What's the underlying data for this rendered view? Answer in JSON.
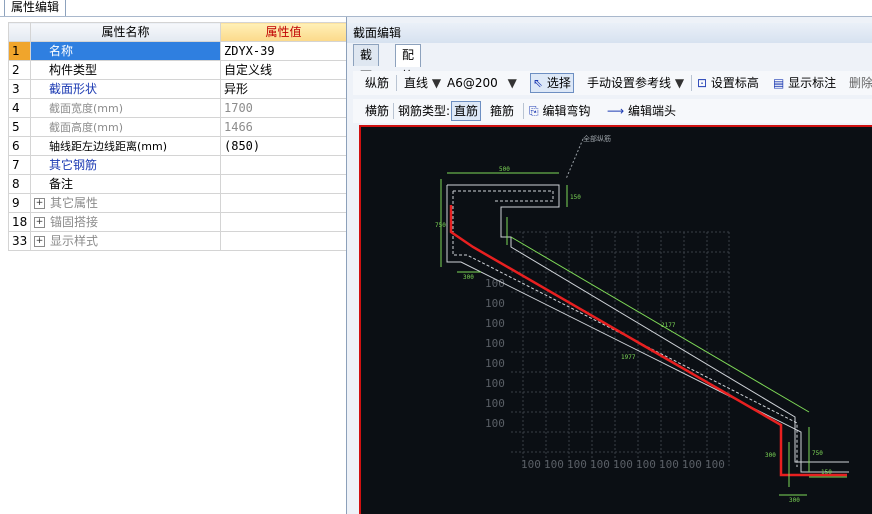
{
  "top_tab": {
    "label": "属性编辑"
  },
  "props": {
    "header": {
      "name": "属性名称",
      "value": "属性值"
    },
    "rows": [
      {
        "num": "1",
        "name": "名称",
        "value": "ZDYX-39"
      },
      {
        "num": "2",
        "name": "构件类型",
        "value": "自定义线"
      },
      {
        "num": "3",
        "name": "截面形状",
        "value": "异形"
      },
      {
        "num": "4",
        "name": "截面宽度(mm)",
        "value": "1700"
      },
      {
        "num": "5",
        "name": "截面高度(mm)",
        "value": "1466"
      },
      {
        "num": "6",
        "name": "轴线距左边线距离(mm)",
        "value": "(850)"
      },
      {
        "num": "7",
        "name": "其它钢筋",
        "value": ""
      },
      {
        "num": "8",
        "name": "备注",
        "value": ""
      },
      {
        "num": "9",
        "name": "其它属性",
        "value": ""
      },
      {
        "num": "18",
        "name": "锚固搭接",
        "value": ""
      },
      {
        "num": "33",
        "name": "显示样式",
        "value": ""
      }
    ]
  },
  "section_editor": {
    "title": "截面编辑",
    "tabs": [
      "截面",
      "配筋"
    ],
    "toolbar1": {
      "longitudinal": "纵筋",
      "line_type": "直线",
      "rebar_spec": "A6@200",
      "select": "选择",
      "manual_ref": "手动设置参考线",
      "set_elevation": "设置标高",
      "show_label": "显示标注",
      "delete": "删除"
    },
    "toolbar2": {
      "transverse": "横筋",
      "rebar_type_label": "钢筋类型:",
      "straight": "直筋",
      "stirrup": "箍筋",
      "edit_bend": "编辑弯钩",
      "edit_end": "编辑端头"
    }
  },
  "canvas": {
    "grid_label": "100",
    "annotation": "全部纵筋"
  },
  "colors": {
    "selection_blue": "#2f7fe0",
    "row_num_orange": "#f0a52c",
    "canvas_bg": "#0b0f14",
    "rebar_red": "#e82020",
    "dim_green": "#7ed957"
  }
}
